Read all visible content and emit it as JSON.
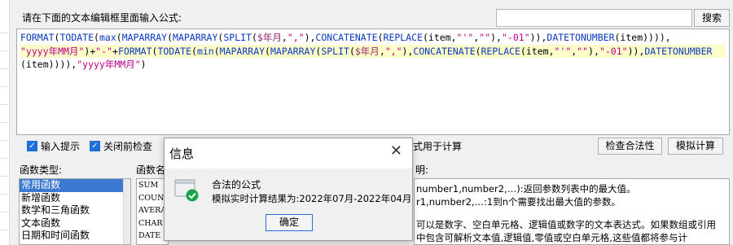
{
  "header": {
    "prompt_label": "请在下面的文本编辑框里面输入公式:",
    "search_placeholder": "",
    "search_button_label": "搜索"
  },
  "editor": {
    "lines": [
      {
        "highlight": false,
        "tokens": [
          [
            "fn",
            "FORMAT"
          ],
          [
            "pl",
            "("
          ],
          [
            "fn",
            "TODATE"
          ],
          [
            "pl",
            "("
          ],
          [
            "fn",
            "max"
          ],
          [
            "pl",
            "("
          ],
          [
            "fn",
            "MAPARRAY"
          ],
          [
            "pl",
            "("
          ],
          [
            "fn",
            "MAPARRAY"
          ],
          [
            "pl",
            "("
          ],
          [
            "fn",
            "SPLIT"
          ],
          [
            "pl",
            "("
          ],
          [
            "var",
            "$年月"
          ],
          [
            "pl",
            ","
          ],
          [
            "str",
            "\",\""
          ],
          [
            "pl",
            "),"
          ],
          [
            "fn",
            "CONCATENATE"
          ],
          [
            "pl",
            "("
          ],
          [
            "fn",
            "REPLACE"
          ],
          [
            "pl",
            "(item,"
          ],
          [
            "str",
            "\"'\""
          ],
          [
            "pl",
            ","
          ],
          [
            "str",
            "\"\""
          ],
          [
            "pl",
            "),"
          ],
          [
            "str",
            "\"-01\""
          ],
          [
            "pl",
            "))"
          ],
          [
            "pl",
            ","
          ],
          [
            "fn",
            "DATETONUMBER"
          ],
          [
            "pl",
            "(item)))),"
          ]
        ]
      },
      {
        "highlight": true,
        "tokens": [
          [
            "str",
            "\"yyyy年MM月\""
          ],
          [
            "pl",
            ")+"
          ],
          [
            "str",
            "\"-\""
          ],
          [
            "pl",
            "+"
          ],
          [
            "fn",
            "FORMAT"
          ],
          [
            "pl",
            "("
          ],
          [
            "fn",
            "TODATE"
          ],
          [
            "pl",
            "("
          ],
          [
            "fn",
            "min"
          ],
          [
            "pl",
            "("
          ],
          [
            "fn",
            "MAPARRAY"
          ],
          [
            "pl",
            "("
          ],
          [
            "fn",
            "MAPARRAY"
          ],
          [
            "pl",
            "("
          ],
          [
            "fn",
            "SPLIT"
          ],
          [
            "pl",
            "("
          ],
          [
            "var",
            "$年月"
          ],
          [
            "pl",
            ","
          ],
          [
            "str",
            "\",\""
          ],
          [
            "pl",
            "),"
          ],
          [
            "fn",
            "CONCATENATE"
          ],
          [
            "pl",
            "("
          ],
          [
            "fn",
            "REPLACE"
          ],
          [
            "pl",
            "(item,"
          ],
          [
            "str",
            "\"'\""
          ],
          [
            "pl",
            ","
          ],
          [
            "str",
            "\"\""
          ],
          [
            "pl",
            "),"
          ],
          [
            "str",
            "\"-01\""
          ],
          [
            "pl",
            "))"
          ],
          [
            "pl",
            ","
          ],
          [
            "fn",
            "DATETONUMBER"
          ]
        ]
      },
      {
        "highlight": false,
        "tokens": [
          [
            "pl",
            "(item)))),"
          ],
          [
            "str",
            "\"yyyy年MM月\""
          ],
          [
            "pl",
            ")"
          ]
        ]
      }
    ]
  },
  "options": {
    "input_hint_label": "输入提示",
    "check_before_close_label": "关闭前检查",
    "use_for_calc_fragment": "式用于计算",
    "check_validity_button": "检查合法性",
    "simulate_button": "模拟计算"
  },
  "function_types": {
    "label": "函数类型:",
    "items": [
      "常用函数",
      "新增函数",
      "数学和三角函数",
      "文本函数",
      "日期和时间函数"
    ]
  },
  "function_names": {
    "label_fragment": "函数名",
    "items": [
      "SUM",
      "COUNT",
      "AVERAGE",
      "CHAR",
      "DATE"
    ]
  },
  "description": {
    "label_fragment": "明:",
    "line1": "number1,number2,…):返回参数列表中的最大值。",
    "line2": "r1,number2,…:1到n个需要找出最大值的参数。",
    "line3": "可以是数字、空白单元格、逻辑值或数字的文本表达式。如果数组或引用",
    "line4": "中包含可解析文本值,逻辑值,零值或空白单元格,这些值都将参与计"
  },
  "dialog": {
    "title": "信息",
    "line1": "合法的公式",
    "line2": "模拟实时计算结果为:2022年07月-2022年04月",
    "ok_label": "确定"
  },
  "colors": {
    "function": "#0b38c0",
    "string": "#b8008a",
    "variable": "#9a2670",
    "highlight": "#fdfdc9",
    "checkbox": "#1e6fd9",
    "success_icon": "#1aa34a"
  }
}
